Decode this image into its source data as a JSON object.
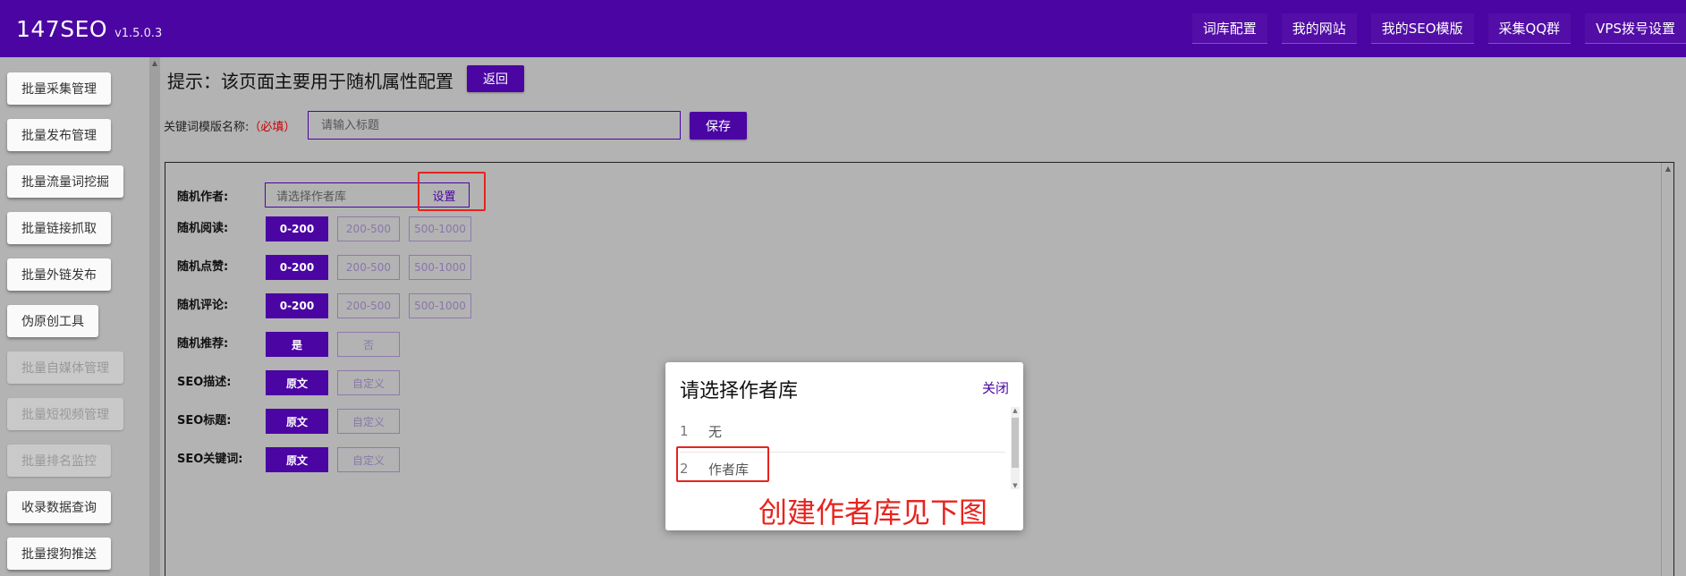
{
  "header": {
    "brand": "147SEO",
    "version": "v1.5.0.3",
    "nav": [
      "词库配置",
      "我的网站",
      "我的SEO模版",
      "采集QQ群",
      "VPS拨号设置"
    ]
  },
  "sidebar": {
    "items": [
      {
        "label": "批量采集管理",
        "disabled": false
      },
      {
        "label": "批量发布管理",
        "disabled": false
      },
      {
        "label": "批量流量词挖掘",
        "disabled": false
      },
      {
        "label": "批量链接抓取",
        "disabled": false
      },
      {
        "label": "批量外链发布",
        "disabled": false
      },
      {
        "label": "伪原创工具",
        "disabled": false
      },
      {
        "label": "批量自媒体管理",
        "disabled": true
      },
      {
        "label": "批量短视频管理",
        "disabled": true
      },
      {
        "label": "批量排名监控",
        "disabled": true
      },
      {
        "label": "收录数据查询",
        "disabled": false
      },
      {
        "label": "批量搜狗推送",
        "disabled": false
      }
    ]
  },
  "page": {
    "title": "提示：该页面主要用于随机属性配置",
    "back_label": "返回",
    "template_label": "关键词模版名称:",
    "template_required": "（必填）",
    "template_placeholder": "请输入标题",
    "save_label": "保存"
  },
  "form": {
    "author_label": "随机作者:",
    "author_placeholder": "请选择作者库",
    "author_set": "设置",
    "rows": [
      {
        "label": "随机阅读:",
        "options": [
          "0-200",
          "200-500",
          "500-1000"
        ],
        "selected": 0
      },
      {
        "label": "随机点赞:",
        "options": [
          "0-200",
          "200-500",
          "500-1000"
        ],
        "selected": 0
      },
      {
        "label": "随机评论:",
        "options": [
          "0-200",
          "200-500",
          "500-1000"
        ],
        "selected": 0
      },
      {
        "label": "随机推荐:",
        "options": [
          "是",
          "否"
        ],
        "selected": 0
      },
      {
        "label": "SEO描述:",
        "options": [
          "原文",
          "自定义"
        ],
        "selected": 0
      },
      {
        "label": "SEO标题:",
        "options": [
          "原文",
          "自定义"
        ],
        "selected": 0
      },
      {
        "label": "SEO关键词:",
        "options": [
          "原文",
          "自定义"
        ],
        "selected": 0
      }
    ]
  },
  "modal": {
    "title": "请选择作者库",
    "close": "关闭",
    "items": [
      {
        "num": "1",
        "label": "无"
      },
      {
        "num": "2",
        "label": "作者库"
      }
    ]
  },
  "annotation": "创建作者库见下图",
  "colors": {
    "accent": "#4b05a3",
    "highlight": "#e8231e",
    "overlay": "#b3b3b3"
  }
}
